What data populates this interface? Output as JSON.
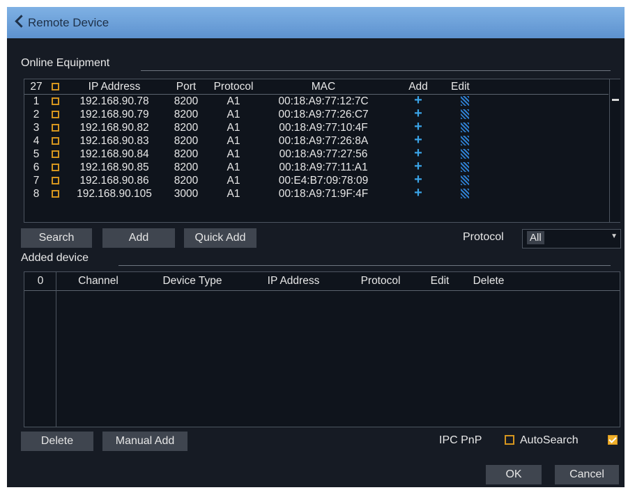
{
  "window": {
    "title": "Remote Device"
  },
  "online": {
    "section_label": "Online Equipment",
    "count": "27",
    "columns": {
      "ip": "IP Address",
      "port": "Port",
      "protocol": "Protocol",
      "mac": "MAC",
      "add": "Add",
      "edit": "Edit"
    },
    "rows": [
      {
        "no": "1",
        "ip": "192.168.90.78",
        "port": "8200",
        "protocol": "A1",
        "mac": "00:18:A9:77:12:7C"
      },
      {
        "no": "2",
        "ip": "192.168.90.79",
        "port": "8200",
        "protocol": "A1",
        "mac": "00:18:A9:77:26:C7"
      },
      {
        "no": "3",
        "ip": "192.168.90.82",
        "port": "8200",
        "protocol": "A1",
        "mac": "00:18:A9:77:10:4F"
      },
      {
        "no": "4",
        "ip": "192.168.90.83",
        "port": "8200",
        "protocol": "A1",
        "mac": "00:18:A9:77:26:8A"
      },
      {
        "no": "5",
        "ip": "192.168.90.84",
        "port": "8200",
        "protocol": "A1",
        "mac": "00:18:A9:77:27:56"
      },
      {
        "no": "6",
        "ip": "192.168.90.85",
        "port": "8200",
        "protocol": "A1",
        "mac": "00:18:A9:77:11:A1"
      },
      {
        "no": "7",
        "ip": "192.168.90.86",
        "port": "8200",
        "protocol": "A1",
        "mac": "00:E4:B7:09:78:09"
      },
      {
        "no": "8",
        "ip": "192.168.90.105",
        "port": "3000",
        "protocol": "A1",
        "mac": "00:18:A9:71:9F:4F"
      }
    ],
    "buttons": {
      "search": "Search",
      "add": "Add",
      "quick_add": "Quick Add"
    },
    "protocol_filter": {
      "label": "Protocol",
      "value": "All"
    }
  },
  "added": {
    "section_label": "Added device",
    "count": "0",
    "columns": {
      "channel": "Channel",
      "device_type": "Device Type",
      "ip": "IP Address",
      "protocol": "Protocol",
      "edit": "Edit",
      "delete": "Delete"
    },
    "buttons": {
      "delete": "Delete",
      "manual_add": "Manual Add"
    },
    "ipc_pnp": {
      "label": "IPC PnP",
      "checked": false
    },
    "autosearch": {
      "label": "AutoSearch",
      "checked": true
    }
  },
  "footer": {
    "ok": "OK",
    "cancel": "Cancel"
  },
  "icons": {
    "back": "chevron-left-icon",
    "add": "plus-icon",
    "edit": "edit-icon",
    "dropdown": "caret-down-icon"
  },
  "colors": {
    "title_bar": "#6a9fd8",
    "background": "#161b24",
    "checkbox": "#d5951e",
    "add_icon": "#3aa3e6"
  }
}
